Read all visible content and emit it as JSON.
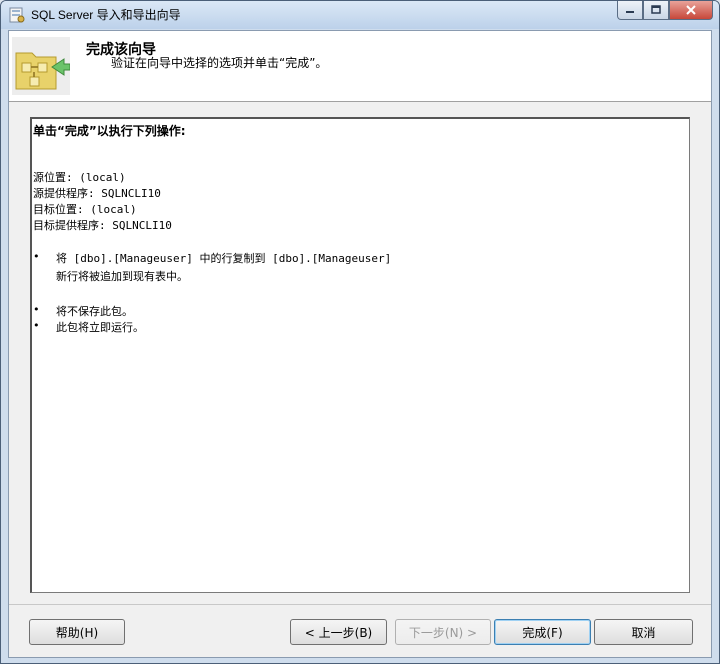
{
  "window": {
    "title": "SQL Server 导入和导出向导"
  },
  "header": {
    "title": "完成该向导",
    "subtitle": "验证在向导中选择的选项并单击“完成”。"
  },
  "summary": {
    "heading": "单击“完成”以执行下列操作:",
    "details": [
      "源位置: (local)",
      "源提供程序: SQLNCLI10",
      "目标位置: (local)",
      "目标提供程序: SQLNCLI10"
    ],
    "bullets": [
      {
        "text": "将 [dbo].[Manageuser] 中的行复制到 [dbo].[Manageuser]",
        "sub": "新行将被追加到现有表中。"
      },
      {
        "text": "将不保存此包。"
      },
      {
        "text": "此包将立即运行。"
      }
    ],
    "bullet_char": "•"
  },
  "buttons": {
    "help": "帮助(H)",
    "back": "< 上一步(B)",
    "next": "下一步(N) >",
    "finish": "完成(F)",
    "cancel": "取消"
  },
  "icons": {
    "app": "sql-server-wizard-icon",
    "header": "package-flow-icon"
  },
  "colors": {
    "titlebar": "#bcd1ea",
    "client": "#f0f0f0",
    "close": "#c7473a"
  }
}
